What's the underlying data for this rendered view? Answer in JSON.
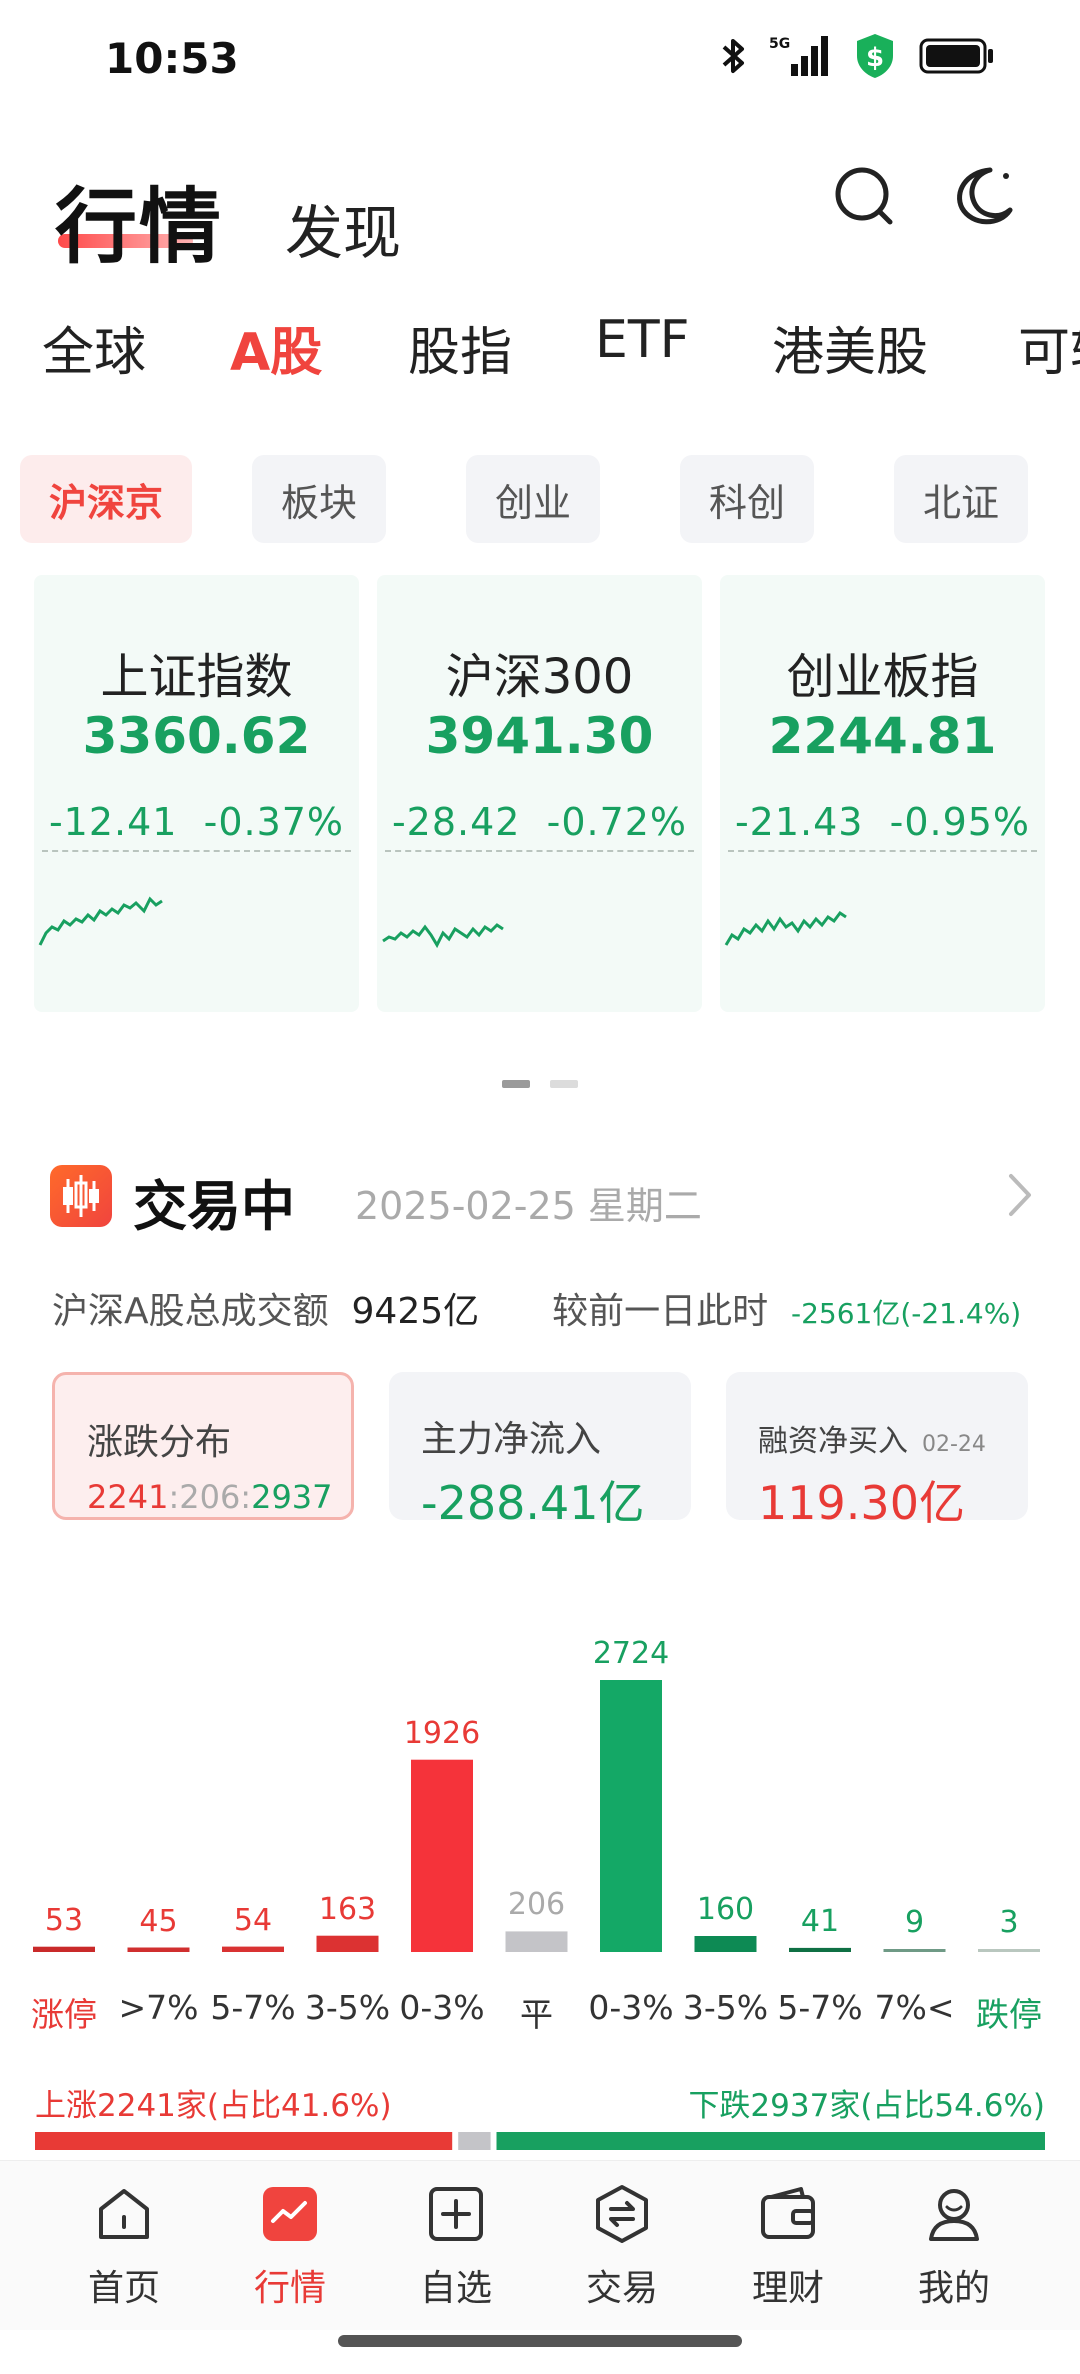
{
  "status": {
    "time": "10:53",
    "network": "5G"
  },
  "header": {
    "title": "行情",
    "subtitle": "发现"
  },
  "tabs": [
    {
      "label": "全球"
    },
    {
      "label": "A股",
      "active": true
    },
    {
      "label": "股指"
    },
    {
      "label": "ETF"
    },
    {
      "label": "港美股"
    },
    {
      "label": "可转"
    }
  ],
  "chips": [
    {
      "label": "沪深京",
      "active": true
    },
    {
      "label": "板块"
    },
    {
      "label": "创业"
    },
    {
      "label": "科创"
    },
    {
      "label": "北证"
    }
  ],
  "indices": [
    {
      "name": "上证指数",
      "value": "3360.62",
      "change": "-12.41",
      "pct": "-0.37%"
    },
    {
      "name": "沪深300",
      "value": "3941.30",
      "change": "-28.42",
      "pct": "-0.72%"
    },
    {
      "name": "创业板指",
      "value": "2244.81",
      "change": "-21.43",
      "pct": "-0.95%"
    }
  ],
  "section": {
    "title": "交易中",
    "date": "2025-02-25 星期二"
  },
  "volume": {
    "label": "沪深A股总成交额",
    "value": "9425亿",
    "compare_label": "较前一日此时",
    "compare_value": "-2561亿(-21.4%)"
  },
  "stats": {
    "dist_label": "涨跌分布",
    "up": "2241",
    "flat": "206",
    "down": "2937",
    "flow_label": "主力净流入",
    "flow_value": "-288.41亿",
    "margin_label": "融资净买入",
    "margin_date": "02-24",
    "margin_value": "119.30亿"
  },
  "distribution": {
    "categories": [
      "涨停",
      ">7%",
      "5-7%",
      "3-5%",
      "0-3%",
      "平",
      "0-3%",
      "3-5%",
      "5-7%",
      "7%<",
      "跌停"
    ],
    "values": [
      53,
      45,
      54,
      163,
      1926,
      206,
      2724,
      160,
      41,
      9,
      3
    ],
    "labels": [
      "53",
      "45",
      "54",
      "163",
      "1926",
      "206",
      "2724",
      "160",
      "41",
      "9",
      "3"
    ],
    "kinds": [
      "up",
      "up",
      "up",
      "up",
      "up",
      "flat",
      "down",
      "down",
      "down",
      "down",
      "down"
    ],
    "bar_colors": [
      "#c92a2a",
      "#d02f2f",
      "#d93232",
      "#dc3232",
      "#f5333a",
      "#c4c4c8",
      "#14a866",
      "#0d8a54",
      "#0f7044",
      "#6f9a86",
      "#b9c7bf"
    ]
  },
  "updown": {
    "up_text": "上涨2241家(占比41.6%)",
    "down_text": "下跌2937家(占比54.6%)",
    "up_share": 0.416,
    "flat_share": 0.038,
    "down_share": 0.546
  },
  "colors": {
    "red": "#e83a36",
    "green": "#18a060",
    "flat": "#c4c4c8"
  },
  "nav": [
    {
      "label": "首页",
      "icon": "home-icon"
    },
    {
      "label": "行情",
      "icon": "market-icon",
      "active": true
    },
    {
      "label": "自选",
      "icon": "watchlist-icon"
    },
    {
      "label": "交易",
      "icon": "trade-icon"
    },
    {
      "label": "理财",
      "icon": "wallet-icon"
    },
    {
      "label": "我的",
      "icon": "profile-icon"
    }
  ]
}
